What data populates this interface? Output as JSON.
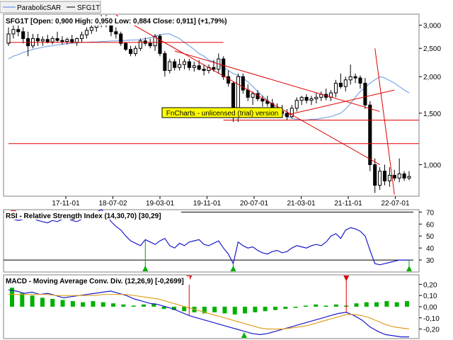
{
  "toolbar": {
    "items": [
      {
        "label": "ParabolicSAR",
        "color": "#7da6e8"
      },
      {
        "label": "SFG1T",
        "color": "#000000"
      }
    ]
  },
  "chart_data": [
    {
      "type": "candlestick",
      "title": "SFG1T [Open: 0,900  High: 0,950  Low: 0,884  Close: 0,911] (+1,79%)",
      "scale": "log",
      "ylim": [
        0.78,
        3.2
      ],
      "ytick_labels": [
        "3,000",
        "2,500",
        "2,000",
        "1,500",
        "1,000"
      ],
      "yticks": [
        3.0,
        2.5,
        2.0,
        1.5,
        1.0
      ],
      "xtick_labels": [
        "17-11-01",
        "18-07-02",
        "19-03-01",
        "19-11-01",
        "20-07-01",
        "21-03-01",
        "21-11-01",
        "22-07-01"
      ],
      "watermark": "FnCharts - unlicensed (trial) version",
      "candles": [
        [
          2.6,
          2.95,
          2.55,
          2.8
        ],
        [
          2.8,
          3.0,
          2.7,
          2.9
        ],
        [
          2.9,
          3.1,
          2.75,
          2.85
        ],
        [
          2.85,
          2.95,
          2.6,
          2.7
        ],
        [
          2.7,
          2.85,
          2.35,
          2.55
        ],
        [
          2.55,
          2.8,
          2.5,
          2.7
        ],
        [
          2.7,
          2.8,
          2.55,
          2.65
        ],
        [
          2.65,
          2.75,
          2.55,
          2.68
        ],
        [
          2.68,
          2.78,
          2.6,
          2.63
        ],
        [
          2.63,
          2.75,
          2.58,
          2.7
        ],
        [
          2.7,
          2.85,
          2.62,
          2.66
        ],
        [
          2.66,
          2.75,
          2.58,
          2.64
        ],
        [
          2.64,
          2.72,
          2.58,
          2.68
        ],
        [
          2.68,
          2.78,
          2.6,
          2.62
        ],
        [
          2.62,
          2.72,
          2.55,
          2.7
        ],
        [
          2.7,
          2.85,
          2.62,
          2.78
        ],
        [
          2.78,
          2.95,
          2.7,
          2.88
        ],
        [
          2.88,
          3.05,
          2.8,
          2.95
        ],
        [
          2.95,
          3.15,
          2.85,
          3.05
        ],
        [
          3.05,
          3.25,
          2.95,
          3.1
        ],
        [
          3.1,
          3.25,
          2.95,
          3.0
        ],
        [
          3.0,
          3.1,
          2.75,
          2.85
        ],
        [
          2.85,
          2.95,
          2.7,
          2.8
        ],
        [
          2.8,
          2.85,
          2.55,
          2.6
        ],
        [
          2.6,
          2.62,
          2.45,
          2.48
        ],
        [
          2.48,
          2.55,
          2.35,
          2.4
        ],
        [
          2.4,
          2.55,
          2.35,
          2.5
        ],
        [
          2.5,
          2.7,
          2.45,
          2.65
        ],
        [
          2.65,
          2.72,
          2.55,
          2.6
        ],
        [
          2.6,
          2.7,
          2.5,
          2.55
        ],
        [
          2.55,
          2.8,
          2.45,
          2.75
        ],
        [
          2.75,
          2.8,
          2.35,
          2.4
        ],
        [
          2.4,
          2.45,
          2.0,
          2.1
        ],
        [
          2.1,
          2.3,
          2.05,
          2.25
        ],
        [
          2.25,
          2.3,
          2.1,
          2.15
        ],
        [
          2.15,
          2.3,
          2.1,
          2.2
        ],
        [
          2.2,
          2.3,
          2.12,
          2.25
        ],
        [
          2.25,
          2.3,
          2.1,
          2.15
        ],
        [
          2.15,
          2.25,
          2.08,
          2.18
        ],
        [
          2.18,
          2.28,
          2.1,
          2.12
        ],
        [
          2.12,
          2.2,
          2.02,
          2.1
        ],
        [
          2.1,
          2.2,
          2.05,
          2.15
        ],
        [
          2.15,
          2.28,
          2.08,
          2.12
        ],
        [
          2.12,
          2.4,
          2.05,
          2.3
        ],
        [
          2.3,
          2.35,
          1.95,
          2.0
        ],
        [
          2.0,
          2.1,
          1.85,
          1.9
        ],
        [
          1.9,
          1.92,
          1.4,
          1.45
        ],
        [
          1.45,
          2.05,
          1.4,
          2.0
        ],
        [
          2.0,
          2.05,
          1.75,
          1.8
        ],
        [
          1.8,
          1.88,
          1.65,
          1.7
        ],
        [
          1.7,
          1.78,
          1.6,
          1.75
        ],
        [
          1.75,
          1.8,
          1.65,
          1.68
        ],
        [
          1.68,
          1.72,
          1.58,
          1.65
        ],
        [
          1.65,
          1.72,
          1.58,
          1.62
        ],
        [
          1.62,
          1.68,
          1.5,
          1.55
        ],
        [
          1.55,
          1.62,
          1.48,
          1.52
        ],
        [
          1.52,
          1.6,
          1.45,
          1.5
        ],
        [
          1.5,
          1.55,
          1.42,
          1.46
        ],
        [
          1.46,
          1.6,
          1.44,
          1.56
        ],
        [
          1.56,
          1.7,
          1.52,
          1.66
        ],
        [
          1.66,
          1.72,
          1.6,
          1.7
        ],
        [
          1.7,
          1.74,
          1.62,
          1.66
        ],
        [
          1.66,
          1.72,
          1.6,
          1.68
        ],
        [
          1.68,
          1.76,
          1.62,
          1.7
        ],
        [
          1.7,
          1.78,
          1.65,
          1.74
        ],
        [
          1.74,
          1.82,
          1.66,
          1.7
        ],
        [
          1.7,
          1.8,
          1.65,
          1.76
        ],
        [
          1.76,
          1.95,
          1.7,
          1.9
        ],
        [
          1.9,
          2.05,
          1.82,
          1.85
        ],
        [
          1.85,
          2.0,
          1.78,
          1.95
        ],
        [
          1.95,
          2.2,
          1.88,
          2.0
        ],
        [
          2.0,
          2.05,
          1.9,
          1.98
        ],
        [
          1.98,
          2.02,
          1.82,
          1.9
        ],
        [
          1.9,
          1.98,
          1.55,
          1.6
        ],
        [
          1.6,
          1.65,
          0.95,
          1.0
        ],
        [
          1.0,
          1.05,
          0.8,
          0.85
        ],
        [
          0.85,
          0.98,
          0.82,
          0.95
        ],
        [
          0.95,
          1.0,
          0.85,
          0.88
        ],
        [
          0.88,
          0.98,
          0.84,
          0.92
        ],
        [
          0.92,
          0.96,
          0.88,
          0.9
        ],
        [
          0.9,
          1.05,
          0.87,
          0.93
        ],
        [
          0.93,
          0.95,
          0.88,
          0.9
        ],
        [
          0.9,
          0.95,
          0.884,
          0.911
        ]
      ],
      "sar_series": {
        "name": "ParabolicSAR",
        "color": "#7da6e8",
        "values": [
          2.3,
          2.35,
          2.38,
          2.42,
          2.45,
          2.48,
          2.5,
          2.52,
          2.54,
          2.55,
          2.57,
          2.58,
          2.59,
          2.6,
          2.61,
          2.62,
          2.62,
          2.63,
          2.63,
          2.64,
          2.64,
          2.65,
          2.65,
          2.66,
          2.66,
          2.67,
          2.67,
          2.68,
          2.7,
          2.72,
          2.75,
          2.78,
          2.8,
          2.8,
          2.75,
          2.7,
          2.62,
          2.55,
          2.48,
          2.4,
          2.35,
          2.28,
          2.25,
          2.2,
          2.15,
          2.1,
          2.05,
          2.02,
          1.98,
          1.92,
          1.85,
          1.78,
          1.72,
          1.66,
          1.6,
          1.55,
          1.5,
          1.46,
          1.44,
          1.43,
          1.42,
          1.42,
          1.43,
          1.43,
          1.44,
          1.45,
          1.46,
          1.48,
          1.5,
          1.55,
          1.62,
          1.7,
          1.78,
          1.84,
          1.9,
          1.95,
          2.0,
          1.98,
          1.94,
          1.9,
          1.85,
          1.8,
          1.76
        ]
      },
      "trendlines": [
        {
          "from": [
            0,
            2.62
          ],
          "to": [
            44,
            2.62
          ]
        },
        {
          "from": [
            22,
            3.25
          ],
          "to": [
            76,
            1.0
          ]
        },
        {
          "from": [
            34,
            2.45
          ],
          "to": [
            76,
            1.52
          ]
        },
        {
          "from": [
            57,
            1.48
          ],
          "to": [
            79,
            1.8
          ]
        },
        {
          "from": [
            44,
            1.42
          ],
          "to": [
            84,
            1.42
          ]
        },
        {
          "from": [
            75,
            2.5
          ],
          "to": [
            79,
            0.79
          ]
        },
        {
          "from": [
            0,
            1.18
          ],
          "to": [
            84,
            1.18
          ]
        }
      ]
    },
    {
      "type": "line",
      "title": "RSI - Relative Strength Index (14,30,70) [30,29]",
      "ylim": [
        20,
        72
      ],
      "ytick_labels": [
        "70",
        "60",
        "50",
        "40",
        "30"
      ],
      "yticks": [
        70,
        60,
        50,
        40,
        30
      ],
      "levels": [
        30,
        70
      ],
      "series": [
        {
          "name": "RSI",
          "color": "#1a1acc",
          "values": [
            68,
            64,
            63,
            64,
            66,
            65,
            63,
            62,
            61,
            63,
            62,
            64,
            65,
            63,
            62,
            64,
            66,
            68,
            70,
            72,
            68,
            62,
            58,
            55,
            50,
            46,
            44,
            42,
            47,
            45,
            43,
            46,
            48,
            42,
            40,
            44,
            42,
            45,
            46,
            47,
            43,
            42,
            44,
            46,
            40,
            35,
            27,
            45,
            42,
            40,
            41,
            38,
            36,
            35,
            37,
            38,
            36,
            37,
            40,
            42,
            41,
            40,
            42,
            43,
            42,
            45,
            50,
            52,
            48,
            55,
            57,
            56,
            54,
            50,
            38,
            27,
            26,
            27,
            28,
            29,
            30,
            30,
            30
          ]
        }
      ],
      "signals": [
        {
          "type": "sell",
          "index": 1
        },
        {
          "type": "buy",
          "index": 28
        },
        {
          "type": "buy",
          "index": 46
        },
        {
          "type": "buy",
          "index": 82
        }
      ]
    },
    {
      "type": "bar",
      "title": "MACD - Moving Average Conv. Div. (12,26,9) [-0,2699]",
      "ylim": [
        -0.26,
        0.26
      ],
      "ytick_labels": [
        "0,20",
        "0,10",
        "0,00",
        "-0,10",
        "-0,20"
      ],
      "yticks": [
        0.2,
        0.1,
        0.0,
        -0.1,
        -0.2
      ],
      "histogram": [
        0.17,
        0.12,
        0.1,
        0.08,
        0.07,
        0.06,
        0.05,
        0.04,
        0.05,
        0.04,
        0.03,
        0.02,
        0.01,
        0.02,
        0.03,
        -0.02,
        -0.03,
        -0.04,
        -0.05,
        -0.06,
        -0.05,
        -0.06,
        -0.07,
        -0.06,
        -0.05,
        -0.04,
        -0.03,
        -0.02,
        -0.01,
        0.01,
        0.02,
        0.01,
        0.02,
        0.01,
        0.03,
        0.04,
        0.04,
        0.05,
        0.04,
        0.05
      ],
      "series": [
        {
          "name": "MACD",
          "color": "#1a1acc",
          "values": [
            0.15,
            0.14,
            0.12,
            0.13,
            0.11,
            0.12,
            0.1,
            0.08,
            0.09,
            0.1,
            0.11,
            0.12,
            0.13,
            0.14,
            0.12,
            0.1,
            0.07,
            0.05,
            0.03,
            0.02,
            0.0,
            -0.02,
            -0.05,
            -0.08,
            -0.1,
            -0.12,
            -0.14,
            -0.16,
            -0.18,
            -0.2,
            -0.22,
            -0.24,
            -0.25,
            -0.24,
            -0.22,
            -0.2,
            -0.18,
            -0.16,
            -0.14,
            -0.12,
            -0.1,
            -0.08,
            -0.06,
            -0.05,
            -0.08,
            -0.12,
            -0.18,
            -0.22,
            -0.25,
            -0.26,
            -0.27,
            -0.27
          ]
        },
        {
          "name": "Signal",
          "color": "#e0a020",
          "values": [
            0.11,
            0.11,
            0.11,
            0.11,
            0.11,
            0.11,
            0.1,
            0.1,
            0.1,
            0.1,
            0.1,
            0.1,
            0.11,
            0.11,
            0.11,
            0.11,
            0.1,
            0.09,
            0.08,
            0.07,
            0.05,
            0.03,
            0.01,
            -0.01,
            -0.03,
            -0.05,
            -0.07,
            -0.09,
            -0.11,
            -0.13,
            -0.15,
            -0.17,
            -0.19,
            -0.2,
            -0.2,
            -0.2,
            -0.19,
            -0.18,
            -0.17,
            -0.15,
            -0.13,
            -0.11,
            -0.09,
            -0.07,
            -0.07,
            -0.08,
            -0.1,
            -0.13,
            -0.16,
            -0.18,
            -0.19,
            -0.2
          ]
        }
      ],
      "signals": [
        {
          "type": "sell",
          "index": 23
        },
        {
          "type": "buy",
          "index": 30
        },
        {
          "type": "sell",
          "index": 43
        }
      ]
    }
  ]
}
